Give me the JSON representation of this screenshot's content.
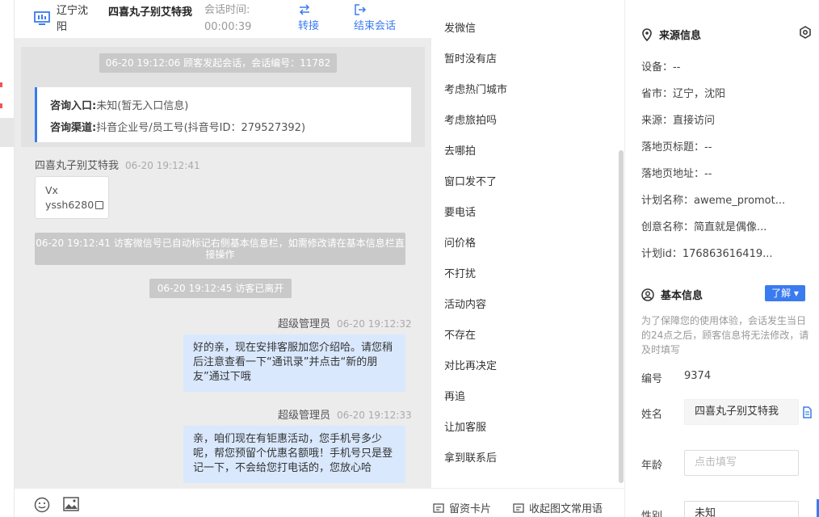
{
  "header": {
    "location": "辽宁沈阳",
    "visitor_name": "四喜丸子别艾特我",
    "session_time_label": "会话时间:",
    "session_time": "00:00:39",
    "transfer_label": "转接",
    "end_label": "结束会话"
  },
  "chat": {
    "session_start": "06-20 19:12:06 顾客发起会话，会话编号：11782",
    "entry_label": "咨询入口:",
    "entry_value": "未知(暂无入口信息)",
    "channel_label": "咨询渠道:",
    "channel_value": "抖音企业号/员工号(抖音号ID：279527392)",
    "visitor_msg_sender": "四喜丸子别艾特我",
    "visitor_msg_time": "06-20 19:12:41",
    "vx_line1": "Vx",
    "vx_line2": "yssh6280",
    "auto_tag_notice": "06-20 19:12:41 访客微信号已自动标记右侧基本信息栏，如需修改请在基本信息栏直接操作",
    "left_notice": "06-20 19:12:45 访客已离开",
    "agent_msgs": [
      {
        "sender": "超级管理员",
        "time": "06-20 19:12:32",
        "text": "好的亲，现在安排客服加您介绍哈。请您稍后注意查看一下“通讯录”并点击“新的朋友”通过下哦"
      },
      {
        "sender": "超级管理员",
        "time": "06-20 19:12:33",
        "text": "亲，咱们现在有钜惠活动，您手机号多少呢，帮您预留个优惠名额哦！手机号只是登记一下，不会给您打电话的，您放心哈"
      }
    ]
  },
  "phrases": {
    "items": [
      "发微信",
      "暂时没有店",
      "考虑热门城市",
      "考虑旅拍吗",
      "去哪拍",
      "窗口发不了",
      "要电话",
      "问价格",
      "不打扰",
      "活动内容",
      "不存在",
      "对比再决定",
      "再追",
      "让加客服",
      "拿到联系后"
    ],
    "footer_card": "留资卡片",
    "footer_collapse": "收起图文常用语"
  },
  "info": {
    "source_title": "来源信息",
    "device": "设备：--",
    "province_city": "省市：辽宁，沈阳",
    "source": "来源：直接访问",
    "landing_title": "落地页标题：--",
    "landing_url": "落地页地址：--",
    "plan_name": "计划名称：aweme_promot...",
    "creative_name": "创意名称：简直就是偶像...",
    "plan_id": "计划id：176863616419...",
    "basic_title": "基本信息",
    "learn_more": "了解",
    "note": "为了保障您的使用体验，会话发生当日的24点之后，顾客信息将无法修改，请及时填写",
    "number_label": "编号",
    "number_value": "9374",
    "name_label": "姓名",
    "name_value": "四喜丸子别艾特我",
    "age_label": "年龄",
    "age_placeholder": "点击填写",
    "gender_label": "性别",
    "gender_value": "未知"
  },
  "colors": {
    "accent": "#3a7bf0",
    "bubble": "#d9e8fd",
    "notice_pill": "#c9c9c9"
  }
}
